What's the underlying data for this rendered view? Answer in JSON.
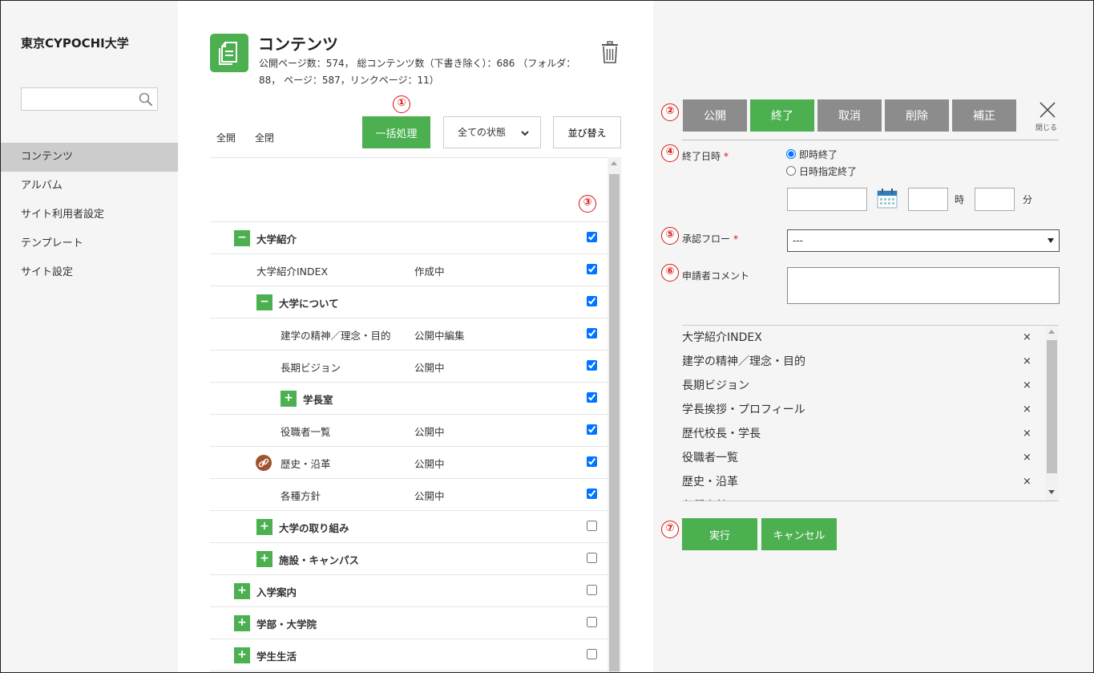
{
  "sidebar": {
    "site_title": "東京CYPOCHI大学",
    "search_placeholder": "",
    "items": [
      {
        "label": "コンテンツ",
        "active": true
      },
      {
        "label": "アルバム"
      },
      {
        "label": "サイト利用者設定"
      },
      {
        "label": "テンプレート"
      },
      {
        "label": "サイト設定"
      }
    ]
  },
  "main": {
    "title": "コンテンツ",
    "stats": "公開ページ数：574， 総コンテンツ数（下書き除く）：686 （フォルダ：88， ページ：587，リンクページ：11）",
    "expand_all": "全開",
    "collapse_all": "全閉",
    "bulk_button": "一括処理",
    "status_filter": "全ての状態",
    "sort_button": "並び替え",
    "markers": {
      "m1": "①",
      "m3": "③"
    },
    "tree": [
      {
        "label": "大学紹介",
        "status": "",
        "toggle": "−",
        "folder": true,
        "checked": true
      },
      {
        "label": "大学紹介INDEX",
        "status": "作成中",
        "toggle": "",
        "folder": false,
        "checked": true
      },
      {
        "label": "大学について",
        "status": "",
        "toggle": "−",
        "folder": true,
        "checked": true
      },
      {
        "label": "建学の精神／理念・目的",
        "status": "公開中編集",
        "toggle": "",
        "folder": false,
        "checked": true
      },
      {
        "label": "長期ビジョン",
        "status": "公開中",
        "toggle": "",
        "folder": false,
        "checked": true
      },
      {
        "label": "学長室",
        "status": "",
        "toggle": "+",
        "folder": true,
        "checked": true
      },
      {
        "label": "役職者一覧",
        "status": "公開中",
        "toggle": "",
        "folder": false,
        "checked": true
      },
      {
        "label": "歴史・沿革",
        "status": "公開中",
        "toggle": "",
        "folder": false,
        "checked": true,
        "link": true
      },
      {
        "label": "各種方針",
        "status": "公開中",
        "toggle": "",
        "folder": false,
        "checked": true
      },
      {
        "label": "大学の取り組み",
        "status": "",
        "toggle": "+",
        "folder": true,
        "checked": false
      },
      {
        "label": "施設・キャンパス",
        "status": "",
        "toggle": "+",
        "folder": true,
        "checked": false
      },
      {
        "label": "入学案内",
        "status": "",
        "toggle": "+",
        "folder": true,
        "checked": false
      },
      {
        "label": "学部・大学院",
        "status": "",
        "toggle": "+",
        "folder": true,
        "checked": false
      },
      {
        "label": "学生生活",
        "status": "",
        "toggle": "+",
        "folder": true,
        "checked": false
      }
    ]
  },
  "panel": {
    "markers": {
      "m2": "②",
      "m4": "④",
      "m5": "⑤",
      "m6": "⑥",
      "m7": "⑦"
    },
    "actions": [
      {
        "label": "公開",
        "active": false
      },
      {
        "label": "終了",
        "active": true
      },
      {
        "label": "取消",
        "active": false
      },
      {
        "label": "削除",
        "active": false
      },
      {
        "label": "補正",
        "active": false
      }
    ],
    "close_label": "閉じる",
    "end_date_label": "終了日時",
    "required_mark": "*",
    "radio_immediate": "即時終了",
    "radio_scheduled": "日時指定終了",
    "hour_label": "時",
    "minute_label": "分",
    "flow_label": "承認フロー",
    "flow_value": "---",
    "comment_label": "申請者コメント",
    "selected_items": [
      "大学紹介INDEX",
      "建学の精神／理念・目的",
      "長期ビジョン",
      "学長挨拶・プロフィール",
      "歴代校長・学長",
      "役職者一覧",
      "歴史・沿革",
      "各種方針"
    ],
    "remove_mark": "×",
    "run_button": "実行",
    "cancel_button": "キャンセル"
  },
  "colors": {
    "accent": "#4caf50",
    "marker": "#d9140f",
    "inactive_button": "#8c8c8c"
  }
}
